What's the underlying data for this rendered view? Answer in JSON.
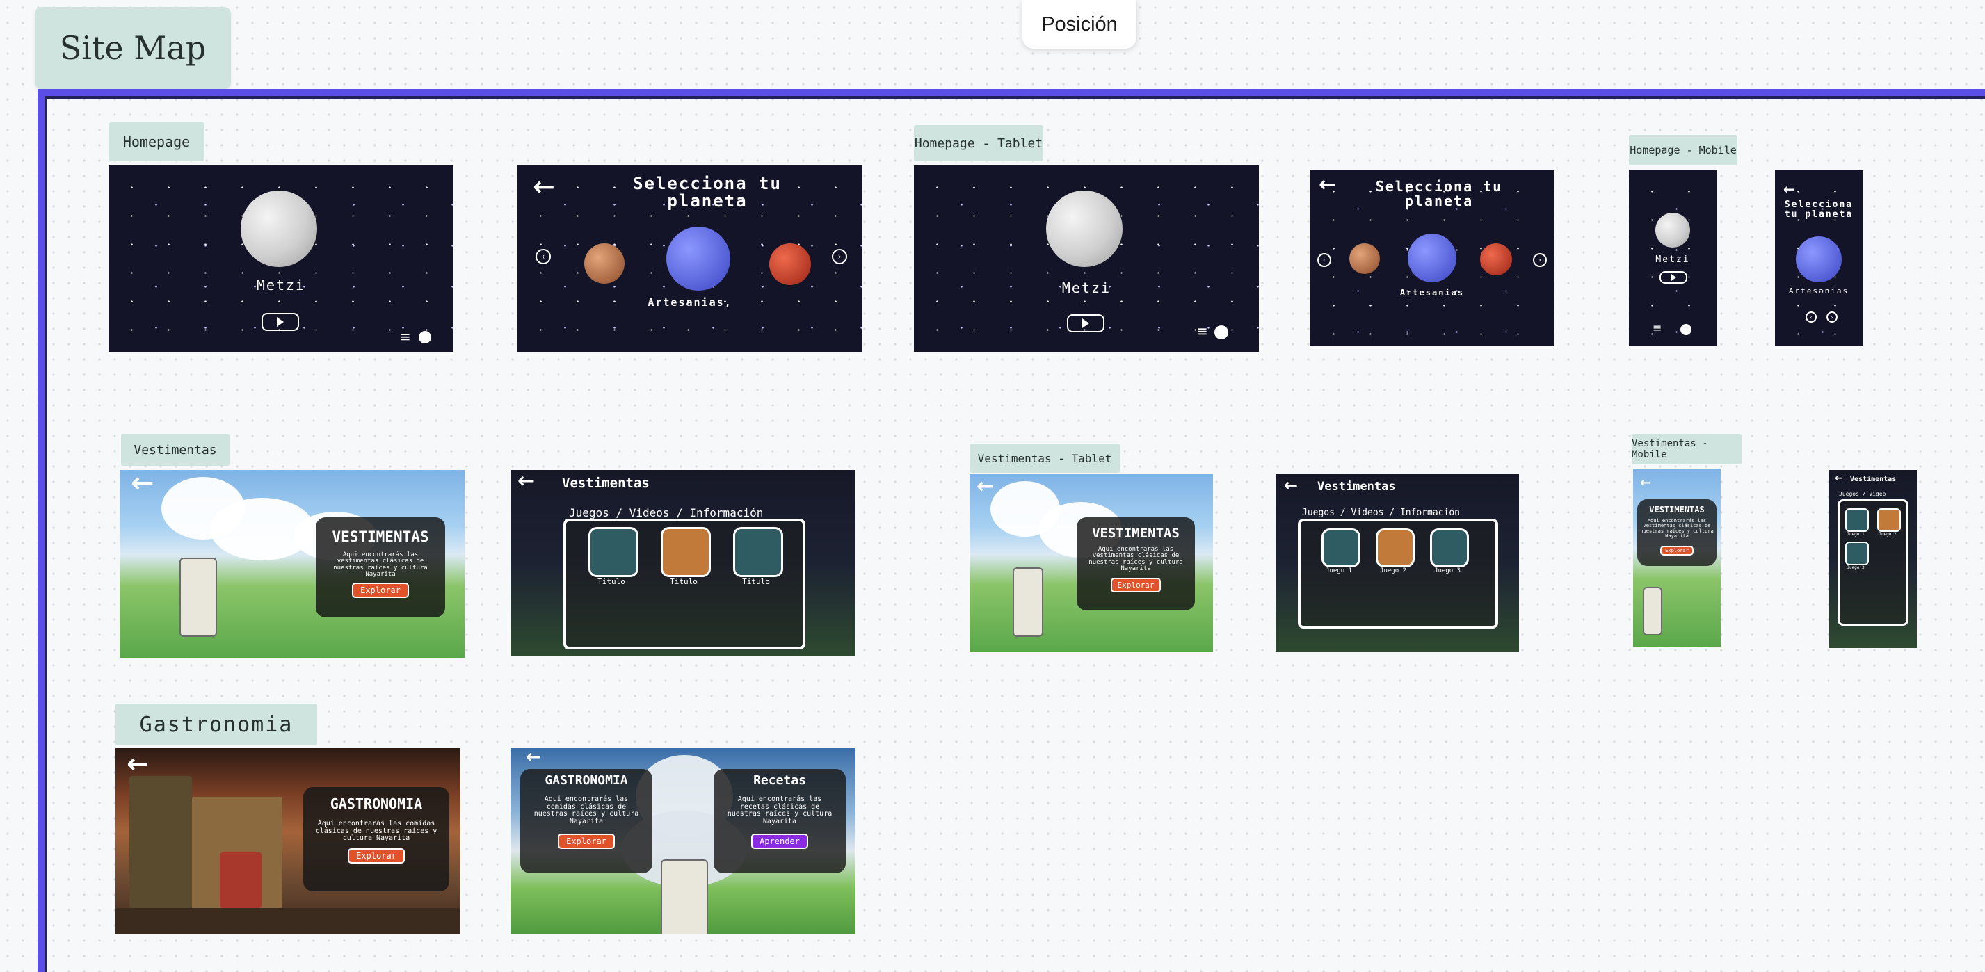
{
  "header": {
    "sitemap_title": "Site Map",
    "position_label": "Posición"
  },
  "labels": {
    "homepage": "Homepage",
    "homepage_tablet": "Homepage - Tablet",
    "homepage_mobile": "Homepage - Mobile",
    "vestimentas": "Vestimentas",
    "vestimentas_tablet": "Vestimentas - Tablet",
    "vestimentas_mobile": "Vestimentas - Mobile",
    "gastronomia": "Gastronomia"
  },
  "home": {
    "moon_name": "Metzi",
    "select_title": "Selecciona tu planeta",
    "planet_name": "Artesanias,",
    "planet_name_tablet": "Artesanias",
    "planet_name_mobile": "Artesanias",
    "menu_glyph": "≡",
    "back_glyph": "←",
    "prev_glyph": "‹",
    "next_glyph": "›"
  },
  "vest": {
    "heading": "VESTIMENTAS",
    "body": "Aqui encontrarás las vestimentas clásicas de nuestras raíces y cultura Nayarita",
    "cta": "Explorar",
    "page_title": "Vestimentas",
    "subnav": "Juegos / Videos / Información",
    "subnav_mobile": "Juegos / Video",
    "cards": [
      "Titulo",
      "Titulo",
      "Titulo"
    ],
    "cards_tablet": [
      "Juego 1",
      "Juego 2",
      "Juego 3"
    ],
    "cards_mobile": [
      "Juego 1",
      "Juego 2",
      "Juego 3"
    ]
  },
  "gastro": {
    "heading": "GASTRONOMIA",
    "body": "Aqui encontrarás las comidas clásicas de nuestras raíces y cultura Nayarita",
    "cta": "Explorar",
    "recetas_heading": "Recetas",
    "recetas_body": "Aqui encontrarás las recetas clásicas de nuestras raíces y cultura Nayarita",
    "recetas_cta": "Aprender"
  },
  "colors": {
    "board_border": "#5b4ee6",
    "label_bg": "#cfe3df",
    "space_bg": "#141428",
    "cta_orange": "#e0532a",
    "cta_purple": "#8a2be2"
  }
}
